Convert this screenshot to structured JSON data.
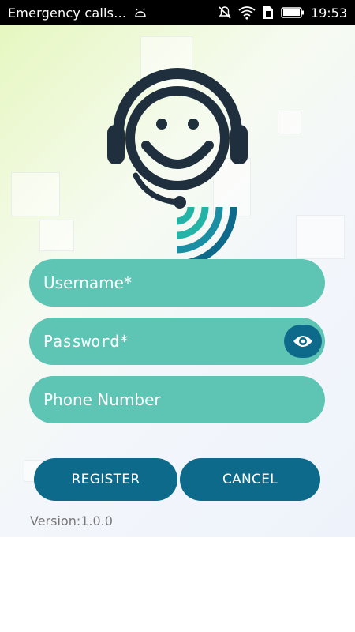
{
  "status_bar": {
    "title": "Emergency calls…",
    "time": "19:53"
  },
  "form": {
    "username_placeholder": "Username*",
    "password_placeholder": "Password*",
    "phone_placeholder": "Phone Number"
  },
  "buttons": {
    "register_label": "REGISTER",
    "cancel_label": "CANCEL"
  },
  "version_text": "Version:1.0.0",
  "colors": {
    "field_fill": "#5ec4b4",
    "button_fill": "#0e6a8a",
    "logo_dark": "#1f2f3d",
    "wave_teal": "#23b3a7",
    "wave_blue": "#0e6a8a"
  },
  "icons": {
    "eye_toggle": "eye-icon",
    "logo": "support-headset-logo"
  }
}
